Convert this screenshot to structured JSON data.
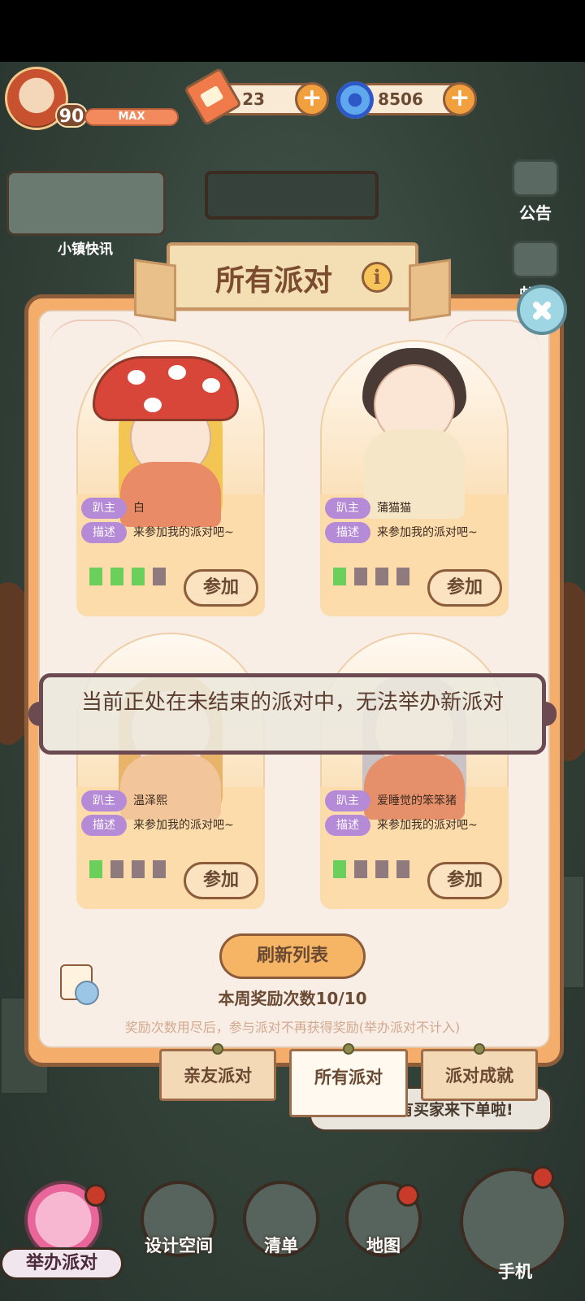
{
  "hud": {
    "level": "90",
    "xp_label": "MAX",
    "tickets": "23",
    "gems": "8506",
    "plus_label": "+"
  },
  "side": {
    "news_label": "小镇快讯",
    "notice_label": "公告",
    "mail_label": "邮件"
  },
  "dialog": {
    "title": "所有派对",
    "info_label": "i",
    "host_tag": "趴主",
    "desc_tag": "描述",
    "join_label": "参加",
    "cards": [
      {
        "host": "白",
        "desc": "来参加我的派对吧~",
        "attendees": 3,
        "capacity": 4
      },
      {
        "host": "蒲猫猫",
        "desc": "来参加我的派对吧~",
        "attendees": 1,
        "capacity": 4
      },
      {
        "host": "温泽熙",
        "desc": "来参加我的派对吧~",
        "attendees": 1,
        "capacity": 4
      },
      {
        "host": "爱睡觉的笨笨猪",
        "desc": "来参加我的派对吧~",
        "attendees": 1,
        "capacity": 4
      }
    ],
    "toast": "当前正处在未结束的派对中，无法举办新派对",
    "refresh_label": "刷新列表",
    "reward_count": "本周奖励次数10/10",
    "reward_note": "奖励次数用尽后，参与派对不再获得奖励(举办派对不计入)",
    "tabs": [
      {
        "label": "亲友派对",
        "active": false
      },
      {
        "label": "所有派对",
        "active": true
      },
      {
        "label": "派对成就",
        "active": false
      }
    ]
  },
  "speech_bubble": "有买家来下单啦!",
  "bottom_nav": {
    "host_party": "举办派对",
    "design_space": "设计空间",
    "list": "清单",
    "map": "地图",
    "phone": "手机"
  },
  "colors": {
    "accent": "#f4ad6a",
    "border": "#8c5c3b",
    "tag": "#b58ad6",
    "attendee_on": "#6bcf5b",
    "attendee_off": "#8f7a7d"
  }
}
